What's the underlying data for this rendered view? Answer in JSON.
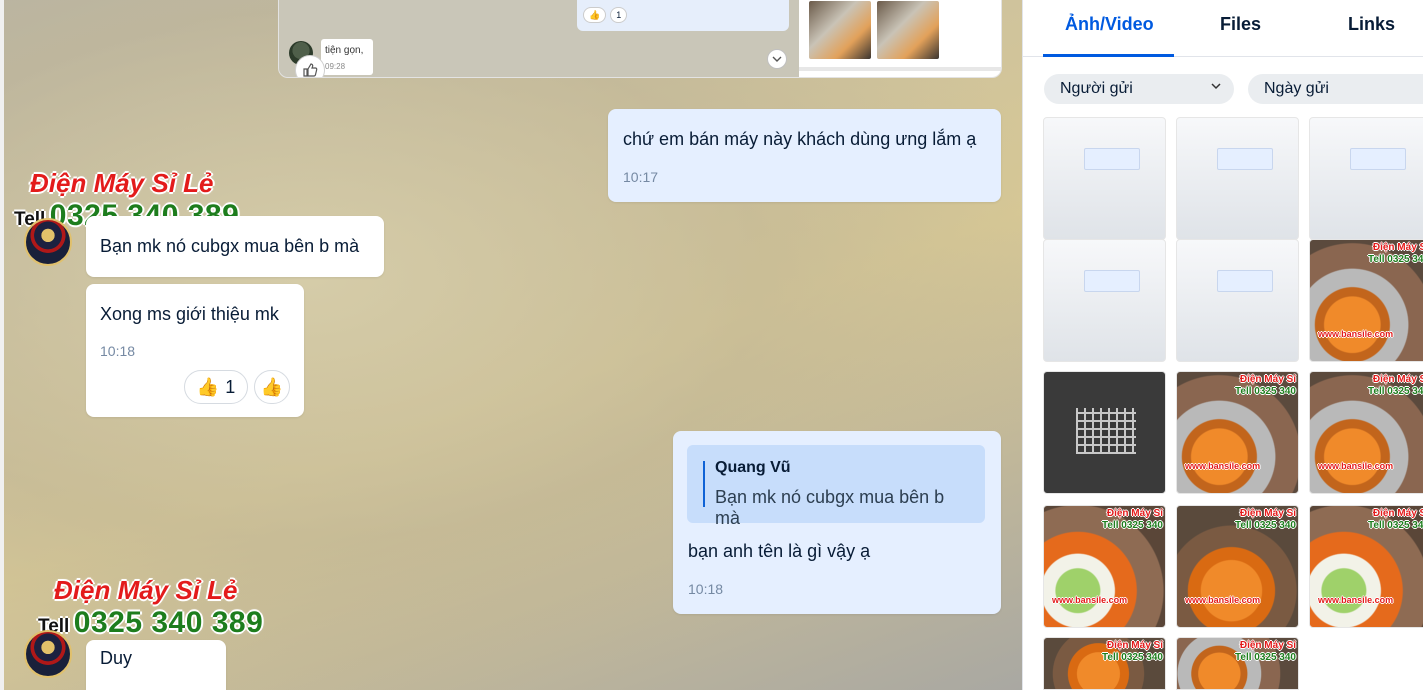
{
  "chat": {
    "quoted_screenshot": {
      "message_text": "tiện gọn,",
      "message_time": "09:28",
      "reaction_count": "1"
    },
    "messages": [
      {
        "text": "chứ em bán máy này khách dùng ưng lắm ạ",
        "time": "10:17"
      },
      {
        "text": "Bạn mk nó cubgx mua bên b mà"
      },
      {
        "text": "Xong ms giới thiệu mk",
        "time": "10:18",
        "reaction_count": "1"
      },
      {
        "quote_author": "Quang Vũ",
        "quote_text": "Bạn mk nó cubgx mua bên b mà",
        "text": "bạn anh tên là gì vậy ạ",
        "time": "10:18"
      },
      {
        "text": "Duy"
      }
    ],
    "watermark": {
      "brand": "Điện Máy Sỉ Lẻ",
      "tell": "Tell",
      "phone": "0325 340 389"
    }
  },
  "panel": {
    "tabs": [
      "Ảnh/Video",
      "Files",
      "Links"
    ],
    "active_tab": "Ảnh/Video",
    "filters": [
      {
        "label": "Người gửi"
      },
      {
        "label": "Ngày gửi"
      }
    ],
    "thumb_watermark": {
      "brand": "Điện Máy Sỉ",
      "tell": "Tell 0325 340",
      "site": "www.bansile.com"
    }
  },
  "colors": {
    "accent": "#005ae0",
    "brand_red": "#e31b1b",
    "phone_green": "#1d7d1d",
    "my_bubble": "#e5efff"
  }
}
